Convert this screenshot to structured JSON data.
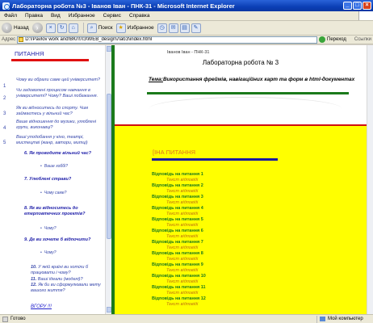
{
  "window": {
    "title": "Лабораторна робота №3 - Іванов Іван - ПНК-31 - Microsoft Internet Explorer",
    "min": "_",
    "max": "□",
    "close": "×"
  },
  "menu": [
    "Файл",
    "Правка",
    "Вид",
    "Избранное",
    "Сервис",
    "Справка"
  ],
  "toolbar": {
    "back": "Назад",
    "search": "Поиск",
    "favorites": "Избранное"
  },
  "address": {
    "label": "Адрес",
    "url": "D:\\!Pavlov work and!ВКЛ!ЛЗ\\WEB_design\\ЛабЗ\\index.html",
    "go": "Переход",
    "links": "Ссылки"
  },
  "left": {
    "title": "ПИТАННЯ",
    "questions": [
      {
        "num": "1",
        "text": "Чому ви обрали саме цей університет?"
      },
      {
        "num": "2",
        "text": "Чи задоволені процесом навчання в університеті? Чому? Ваші побажання."
      },
      {
        "num": "3",
        "text": "Як ви відноситесь до спорту. Чим займаєтесь у вільний час?"
      },
      {
        "num": "4",
        "text": "Ваше відношення до музики, улюблені групи, виконавці?"
      },
      {
        "num": "5",
        "text": "Ваші уподобання у кіно, театрі, мистецтві (жанр, автори, митці)"
      }
    ],
    "items": [
      {
        "num": "6.",
        "text": "Як проводите вільний час?",
        "sub": "Ваше хоббі?"
      },
      {
        "num": "7.",
        "text": "Улюблені страви?",
        "sub": "Чому саме?"
      },
      {
        "num": "8.",
        "text": "Як ви відноситесь до етерповтечних проектів?",
        "sub": "Чому?"
      },
      {
        "num": "9.",
        "text": "Де ви хочете б відпочити?",
        "sub": "Чому?"
      }
    ],
    "last": [
      {
        "num": "10.",
        "text": "У якій країні ви хотіли б працювати і чому?"
      },
      {
        "num": "11.",
        "text": "Ваші ідеали (моделі)?"
      },
      {
        "num": "12.",
        "text": "Як би ви сформулювали мету вашого життя?"
      }
    ],
    "back_link": "ВГОРУ !!!"
  },
  "right": {
    "author": "Іванов Іван - ПНК-31",
    "lab_title": "Лабораторна робота № 3",
    "topic_label": "Тема:",
    "topic_text": "Використання фреймів, навігаційних карт та форм в html-документах",
    "answers_heading": "[ІНА ПИТАННЯ",
    "answers": [
      {
        "title": "Відповідь на питання 1",
        "text": "Текст відповіді"
      },
      {
        "title": "Відповідь на питання 2",
        "text": "Текст відповіді"
      },
      {
        "title": "Відповідь на питання 3",
        "text": "Текст відповіді"
      },
      {
        "title": "Відповідь на питання 4",
        "text": "Текст відповіді"
      },
      {
        "title": "Відповідь на питання 5",
        "text": "Текст відповіді"
      },
      {
        "title": "Відповідь на питання 6",
        "text": "Текст відповіді"
      },
      {
        "title": "Відповідь на питання 7",
        "text": "Текст відповіді"
      },
      {
        "title": "Відповідь на питання 8",
        "text": "Текст відповіді"
      },
      {
        "title": "Відповідь на питання 9",
        "text": "Текст відповіді"
      },
      {
        "title": "Відповідь на питання 10",
        "text": "Текст відповіді"
      },
      {
        "title": "Відповідь на питання 11",
        "text": "Текст відповіді"
      },
      {
        "title": "Відповідь на питання 12",
        "text": "Текст відповіді"
      }
    ]
  },
  "status": {
    "text": "Готово",
    "zone": "Мой компьютер"
  }
}
